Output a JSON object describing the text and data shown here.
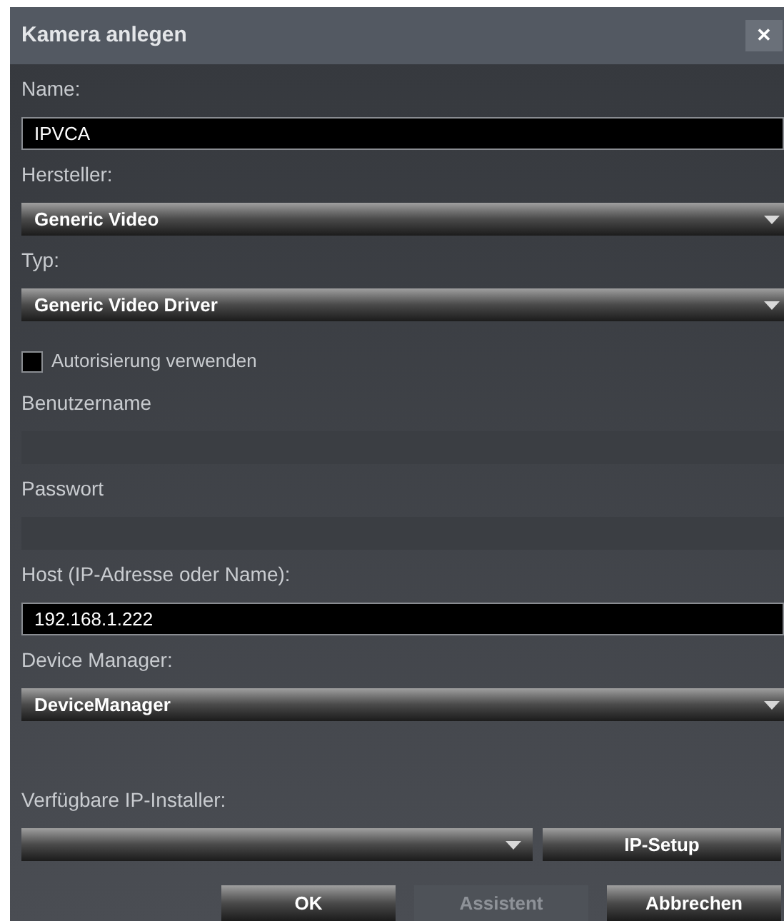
{
  "dialog": {
    "title": "Kamera anlegen",
    "close": "✕"
  },
  "fields": [
    {
      "kind": "text",
      "label": "Name:",
      "value": "IPVCA",
      "disabled": false
    },
    {
      "kind": "select",
      "label": "Hersteller:",
      "value": "Generic Video"
    },
    {
      "kind": "select",
      "label": "Typ:",
      "value": "Generic Video Driver"
    },
    {
      "kind": "checkbox",
      "label": "Autorisierung verwenden",
      "checked": false
    },
    {
      "kind": "text",
      "label": "Benutzername",
      "disabled": true
    },
    {
      "kind": "text",
      "label": "Passwort",
      "disabled": true
    },
    {
      "kind": "text",
      "label": "Host (IP-Adresse oder Name):",
      "value": "192.168.1.222",
      "disabled": false
    },
    {
      "kind": "select",
      "label": "Device Manager:",
      "value": "DeviceManager"
    }
  ],
  "installer": {
    "label": "Verfügbare IP-Installer:",
    "button": "IP-Setup"
  },
  "buttons": [
    {
      "label": "OK",
      "disabled": false
    },
    {
      "label": "Assistent",
      "disabled": true
    },
    {
      "label": "Abbrechen",
      "disabled": false
    }
  ]
}
